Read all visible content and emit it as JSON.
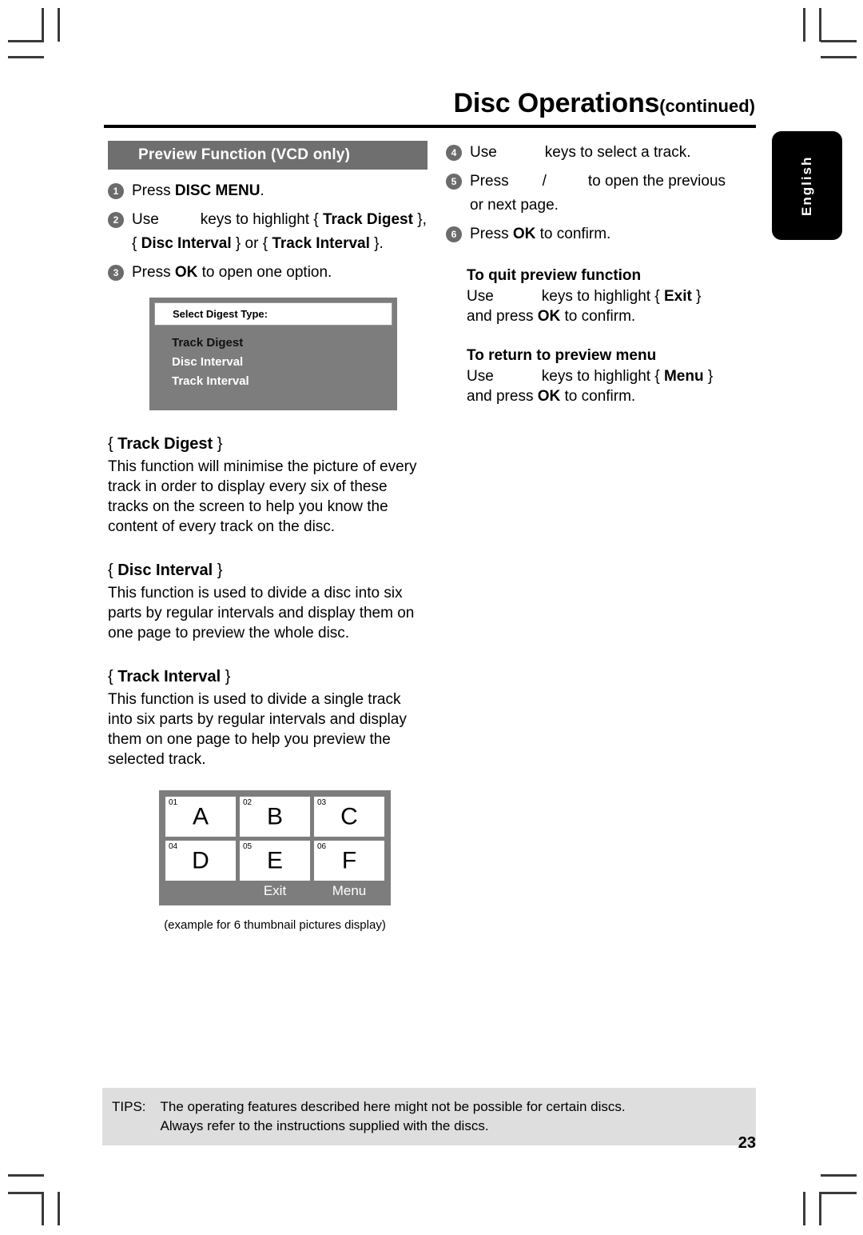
{
  "header": {
    "title": "Disc Operations",
    "continued": "(continued)"
  },
  "language_tab": {
    "label": "English"
  },
  "left_column": {
    "section_title": "Preview Function (VCD only)",
    "steps": [
      {
        "num": "1",
        "text_before": "Press ",
        "bold": "DISC MENU",
        "text_after": "."
      },
      {
        "num": "2",
        "line1_a": "Use",
        "line1_b": "keys to highlight {",
        "line1_bold": "Track Digest",
        "line1_c": "},",
        "line2_a": "{",
        "line2_bold1": "Disc Interval",
        "line2_b": "} or {",
        "line2_bold2": "Track Interval",
        "line2_c": "}."
      },
      {
        "num": "3",
        "text_before": "Press ",
        "bold": "OK",
        "text_after": " to open one option."
      }
    ],
    "osd": {
      "header": "Select Digest Type:",
      "items": [
        {
          "label": "Track Digest",
          "selected": true
        },
        {
          "label": "Disc Interval",
          "selected": false
        },
        {
          "label": "Track Interval",
          "selected": false
        }
      ]
    },
    "definitions": [
      {
        "brace_open": "{",
        "term": "Track Digest",
        "brace_close": "}",
        "body": "This function will minimise the picture of every track in order to display every six of these tracks on the screen to help you know the content of every track on the disc."
      },
      {
        "brace_open": "{",
        "term": "Disc Interval",
        "brace_close": "}",
        "body": "This function is used to divide a disc into six parts by regular intervals and display them on one page to preview the whole disc."
      },
      {
        "brace_open": "{",
        "term": "Track Interval",
        "brace_close": "}",
        "body": "This function is used to divide a single track into six parts by regular intervals and display them on one page to help you preview the selected track."
      }
    ],
    "thumbnail_example": {
      "cells": [
        {
          "index": "01",
          "letter": "A"
        },
        {
          "index": "02",
          "letter": "B"
        },
        {
          "index": "03",
          "letter": "C"
        },
        {
          "index": "04",
          "letter": "D"
        },
        {
          "index": "05",
          "letter": "E"
        },
        {
          "index": "06",
          "letter": "F"
        }
      ],
      "bar": {
        "blank": "",
        "exit": "Exit",
        "menu": "Menu"
      },
      "caption": "(example for 6 thumbnail pictures display)"
    }
  },
  "right_column": {
    "steps": [
      {
        "num": "4",
        "a": "Use",
        "b": "keys to select a track."
      },
      {
        "num": "5",
        "a": "Press",
        "slash": "/",
        "b": "to open the previous",
        "line2": "or next page."
      },
      {
        "num": "6",
        "a": "Press ",
        "bold": "OK",
        "b": " to confirm."
      }
    ],
    "quit_section": {
      "heading": "To quit preview function",
      "a": "Use",
      "b": "keys to highlight {",
      "bold_target": "Exit",
      "c": "}",
      "line2_a": "and press ",
      "line2_bold": "OK",
      "line2_b": " to confirm."
    },
    "return_section": {
      "heading": "To return to preview menu",
      "a": "Use",
      "b": "keys to highlight {",
      "bold_target": "Menu",
      "c": "}",
      "line2_a": "and press ",
      "line2_bold": "OK",
      "line2_b": " to confirm."
    }
  },
  "footer": {
    "tips_label": "TIPS:",
    "tips_line1": "The operating features described here might not be possible for certain discs.",
    "tips_line2": "Always refer to the instructions supplied with the discs.",
    "page_number": "23"
  }
}
